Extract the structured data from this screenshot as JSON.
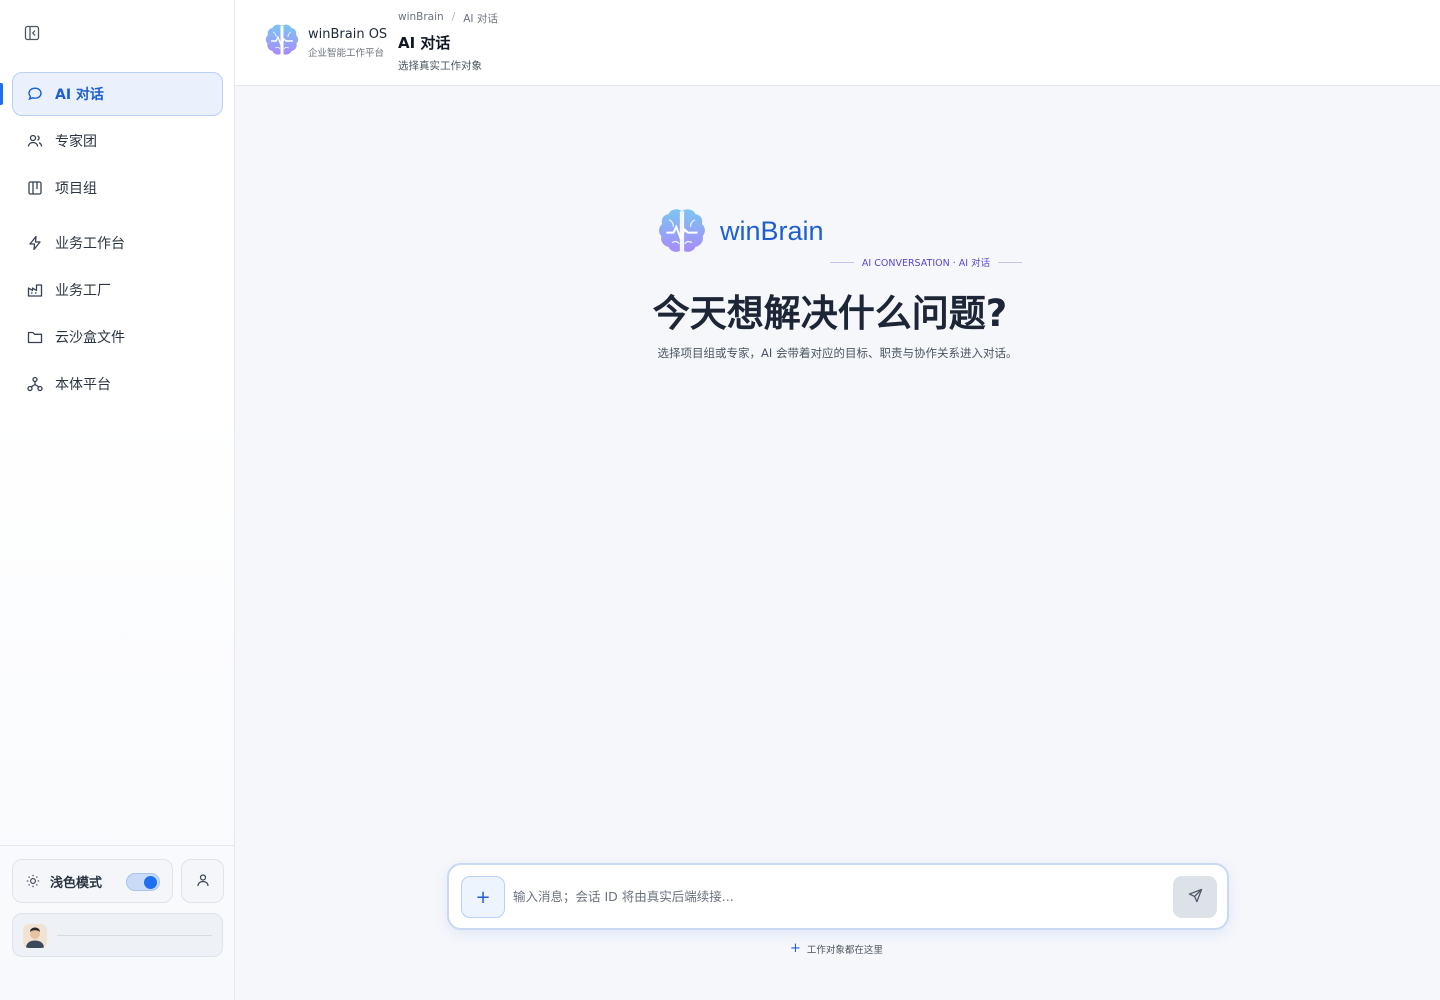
{
  "sidebar": {
    "items": [
      {
        "label": "AI 对话",
        "icon": "chat-bubble-icon",
        "active": true
      },
      {
        "label": "专家团",
        "icon": "users-icon"
      },
      {
        "label": "项目组",
        "icon": "board-icon"
      },
      {
        "label": "业务工作台",
        "icon": "lightning-icon"
      },
      {
        "label": "业务工厂",
        "icon": "factory-icon"
      },
      {
        "label": "云沙盒文件",
        "icon": "folder-icon"
      },
      {
        "label": "本体平台",
        "icon": "network-icon"
      }
    ],
    "theme_label": "浅色模式",
    "theme_on": true
  },
  "header": {
    "brand_name": "winBrain OS",
    "brand_sub": "企业智能工作平台",
    "breadcrumbs": [
      "winBrain",
      "AI 对话"
    ],
    "title": "AI 对话",
    "subtitle": "选择真实工作对象"
  },
  "hero": {
    "brand": "winBrain",
    "tag": "AI CONVERSATION · AI 对话",
    "title": "今天想解决什么问题?",
    "description": "选择项目组或专家，AI 会带着对应的目标、职责与协作关系进入对话。"
  },
  "composer": {
    "placeholder": "输入消息；会话 ID 将由真实后端续接...",
    "attach_symbol": "+",
    "hint": "工作对象都在这里"
  },
  "colors": {
    "accent": "#1d5fd1",
    "active_bg": "#eaf1fd",
    "tag_purple": "#5b47c7"
  }
}
